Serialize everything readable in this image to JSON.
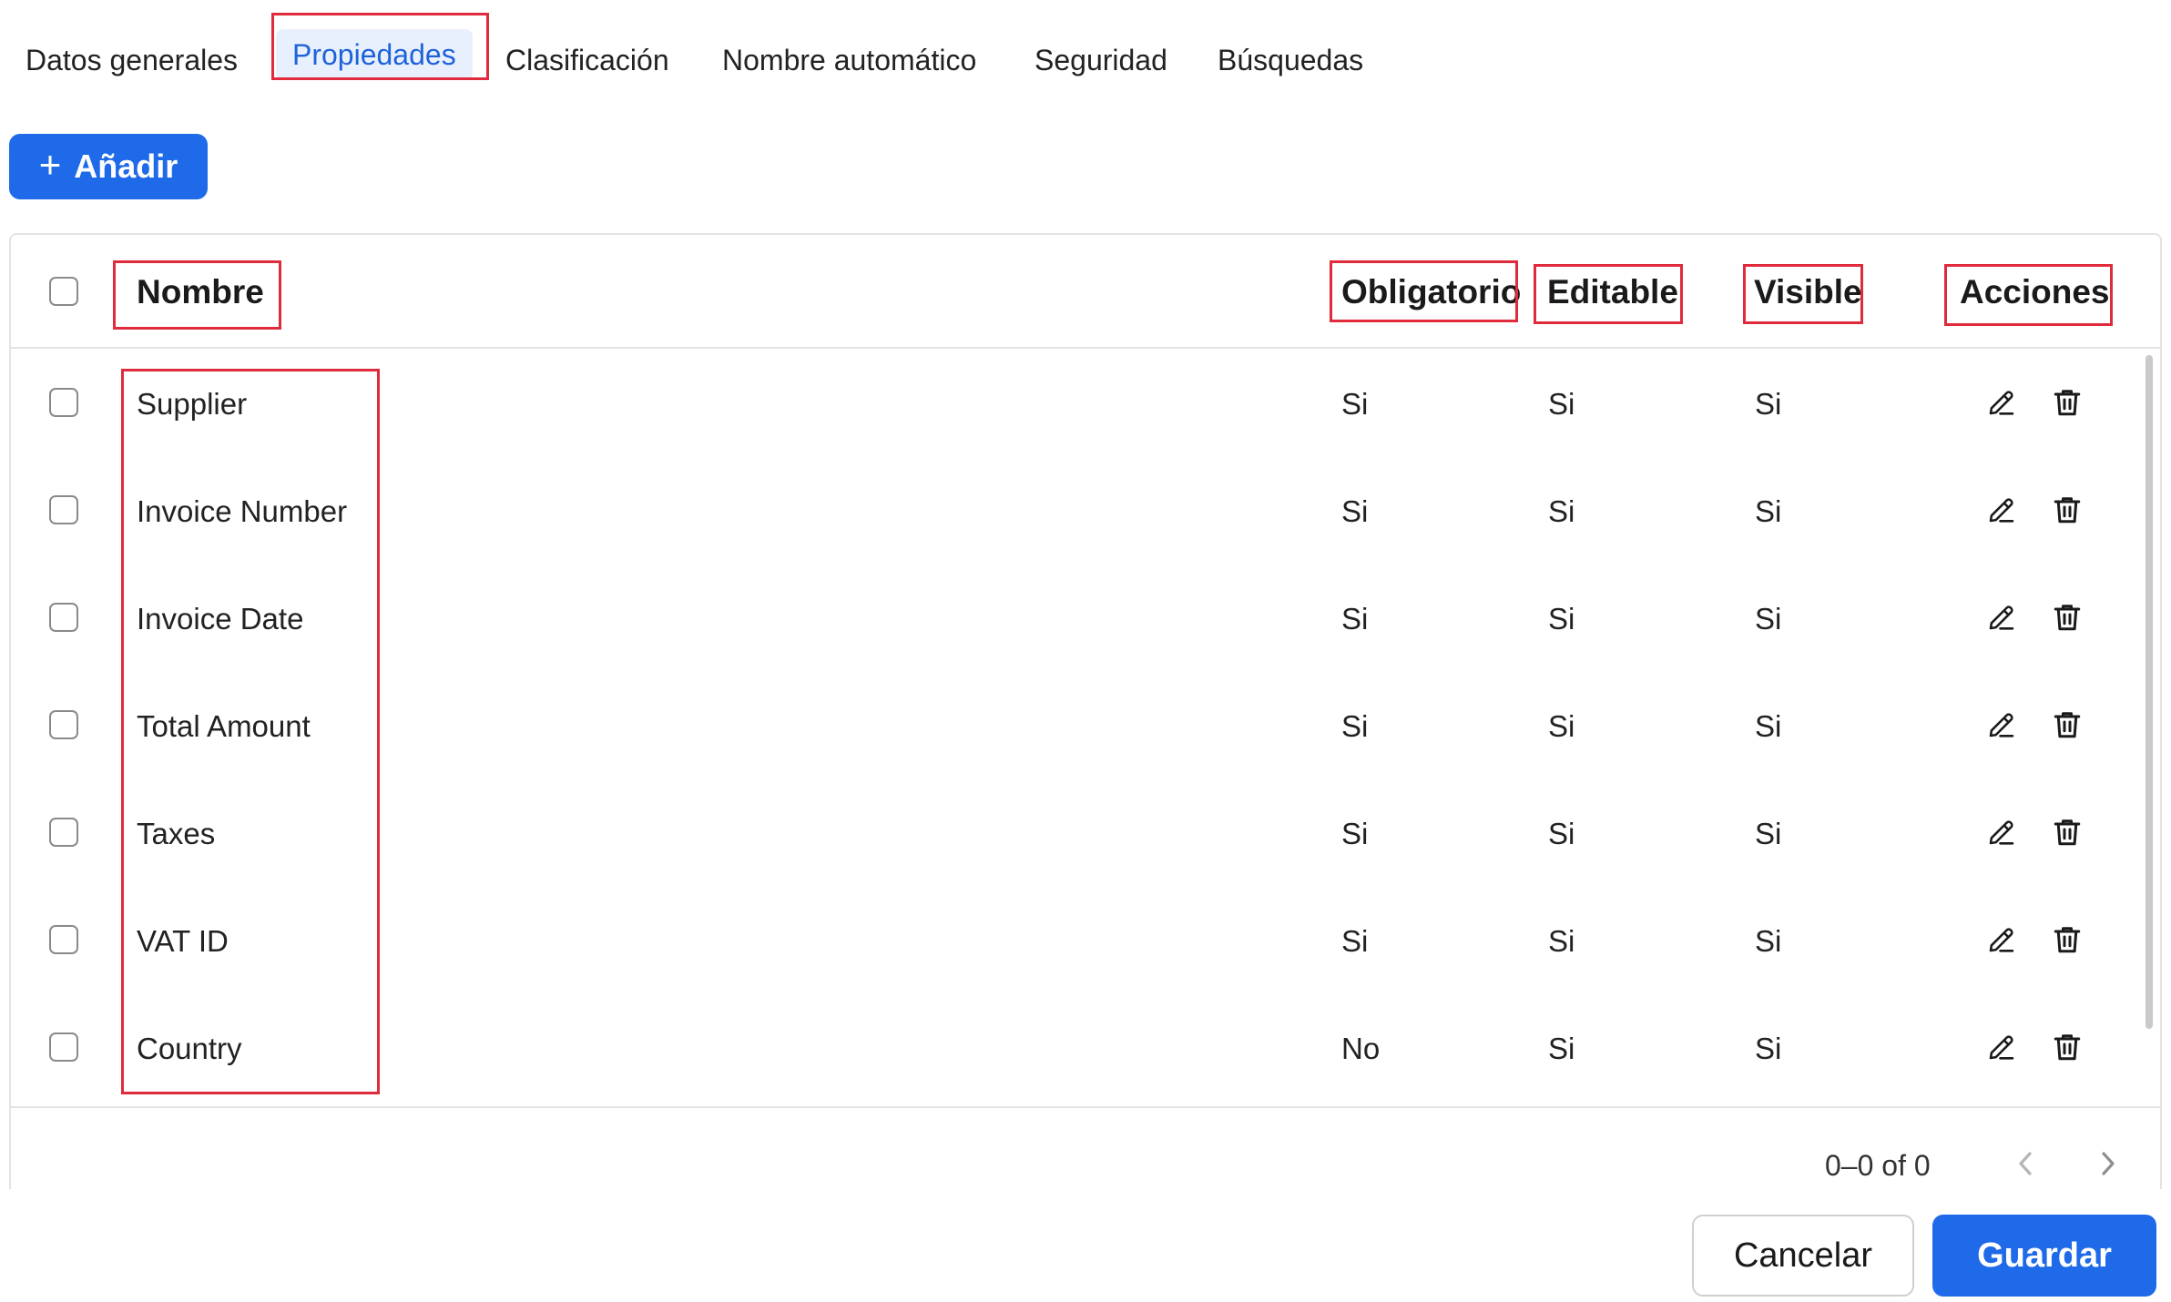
{
  "tabs": [
    {
      "label": "Datos generales"
    },
    {
      "label": "Propiedades"
    },
    {
      "label": "Clasificación"
    },
    {
      "label": "Nombre automático"
    },
    {
      "label": "Seguridad"
    },
    {
      "label": "Búsquedas"
    }
  ],
  "active_tab": "Propiedades",
  "toolbar": {
    "add_label": "Añadir",
    "add_icon": "plus-icon"
  },
  "table": {
    "headers": {
      "name": "Nombre",
      "required": "Obligatorio",
      "editable": "Editable",
      "visible": "Visible",
      "actions": "Acciones"
    },
    "rows": [
      {
        "name": "Supplier",
        "required": "Si",
        "editable": "Si",
        "visible": "Si"
      },
      {
        "name": "Invoice Number",
        "required": "Si",
        "editable": "Si",
        "visible": "Si"
      },
      {
        "name": "Invoice Date",
        "required": "Si",
        "editable": "Si",
        "visible": "Si"
      },
      {
        "name": "Total Amount",
        "required": "Si",
        "editable": "Si",
        "visible": "Si"
      },
      {
        "name": "Taxes",
        "required": "Si",
        "editable": "Si",
        "visible": "Si"
      },
      {
        "name": "VAT ID",
        "required": "Si",
        "editable": "Si",
        "visible": "Si"
      },
      {
        "name": "Country",
        "required": "No",
        "editable": "Si",
        "visible": "Si"
      }
    ],
    "action_icons": [
      "pencil-icon",
      "trash-icon"
    ]
  },
  "pagination": {
    "text": "0–0 of 0",
    "prev_icon": "chevron-left-icon",
    "next_icon": "chevron-right-icon"
  },
  "footer": {
    "cancel_label": "Cancelar",
    "save_label": "Guardar"
  },
  "colors": {
    "accent": "#1f6ae8",
    "highlight_box": "#e02b3c",
    "active_tab_text": "#1f63d9",
    "active_tab_bg": "#e8f0fd"
  }
}
